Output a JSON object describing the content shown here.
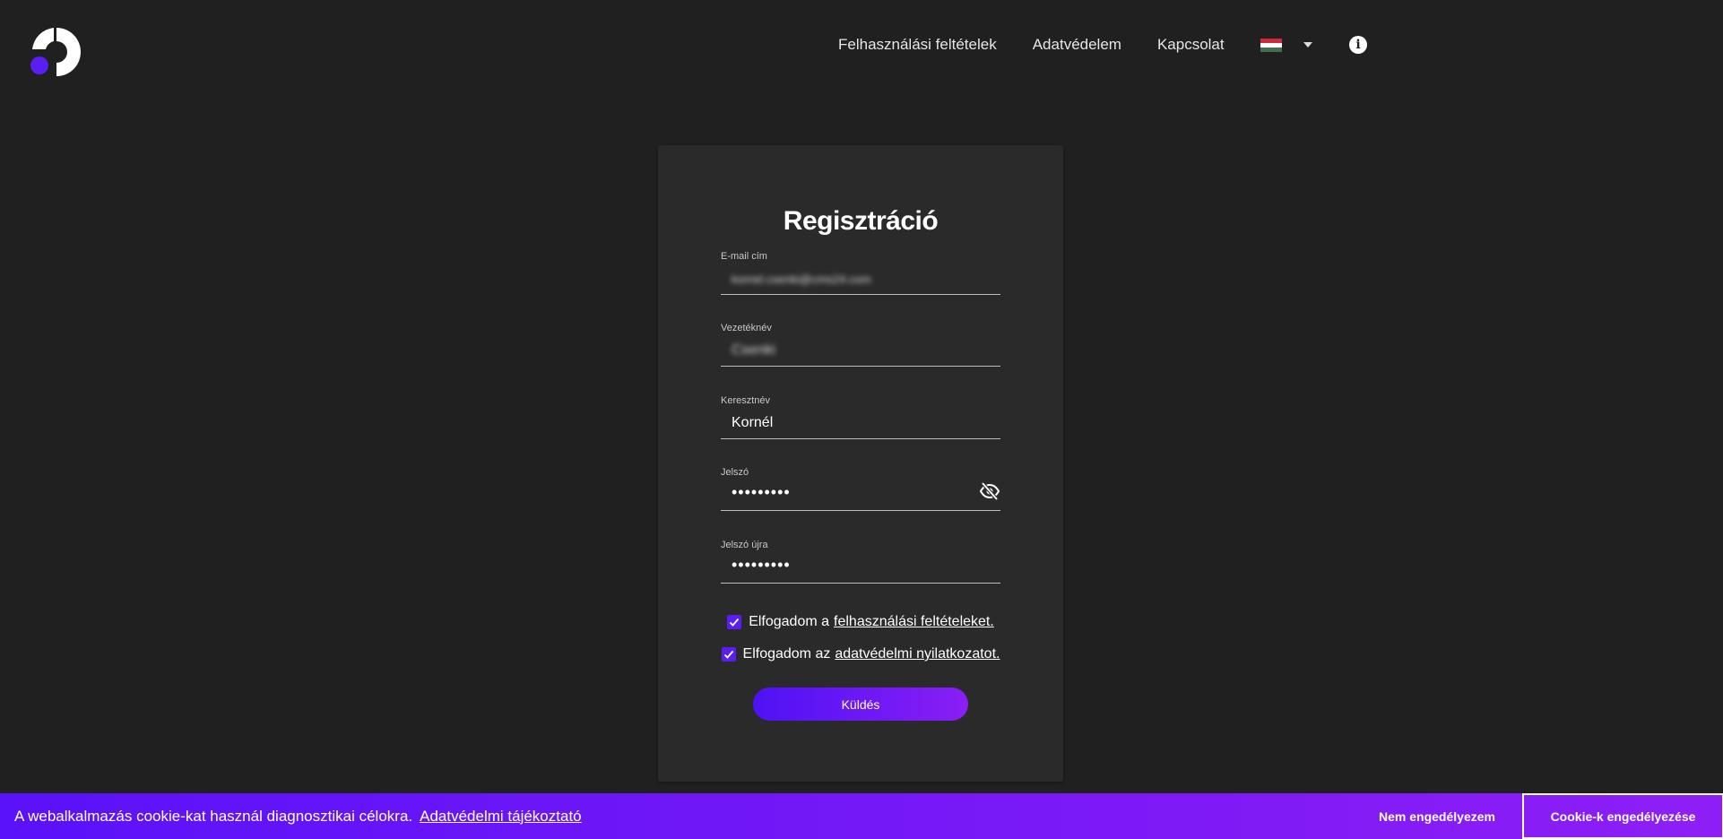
{
  "nav": {
    "terms": "Felhasználási feltételek",
    "privacy": "Adatvédelem",
    "contact": "Kapcsolat"
  },
  "brand_colors": {
    "accent": "#5a1ef2",
    "accent_end": "#8e1ef6",
    "background": "#202020",
    "card": "#2a2a2a"
  },
  "form": {
    "title": "Regisztráció",
    "email": {
      "label": "E-mail cím",
      "value": "kornel.csenki@cms24.com"
    },
    "lastname": {
      "label": "Vezetéknév",
      "value": "Csenki"
    },
    "firstname": {
      "label": "Keresztnév",
      "value": "Kornél"
    },
    "password": {
      "label": "Jelszó",
      "value": "•••••••••"
    },
    "password_again": {
      "label": "Jelszó újra",
      "value": "•••••••••"
    },
    "terms_text": "Elfogadom a",
    "terms_link": "felhasználási feltételeket.",
    "privacy_text": "Elfogadom az",
    "privacy_link": "adatvédelmi nyilatkozatot.",
    "submit": "Küldés"
  },
  "cookie": {
    "message": "A webalkalmazás cookie-kat használ diagnosztikai célokra.",
    "link": "Adatvédelmi tájékoztató",
    "deny": "Nem engedélyezem",
    "allow": "Cookie-k engedélyezése"
  }
}
